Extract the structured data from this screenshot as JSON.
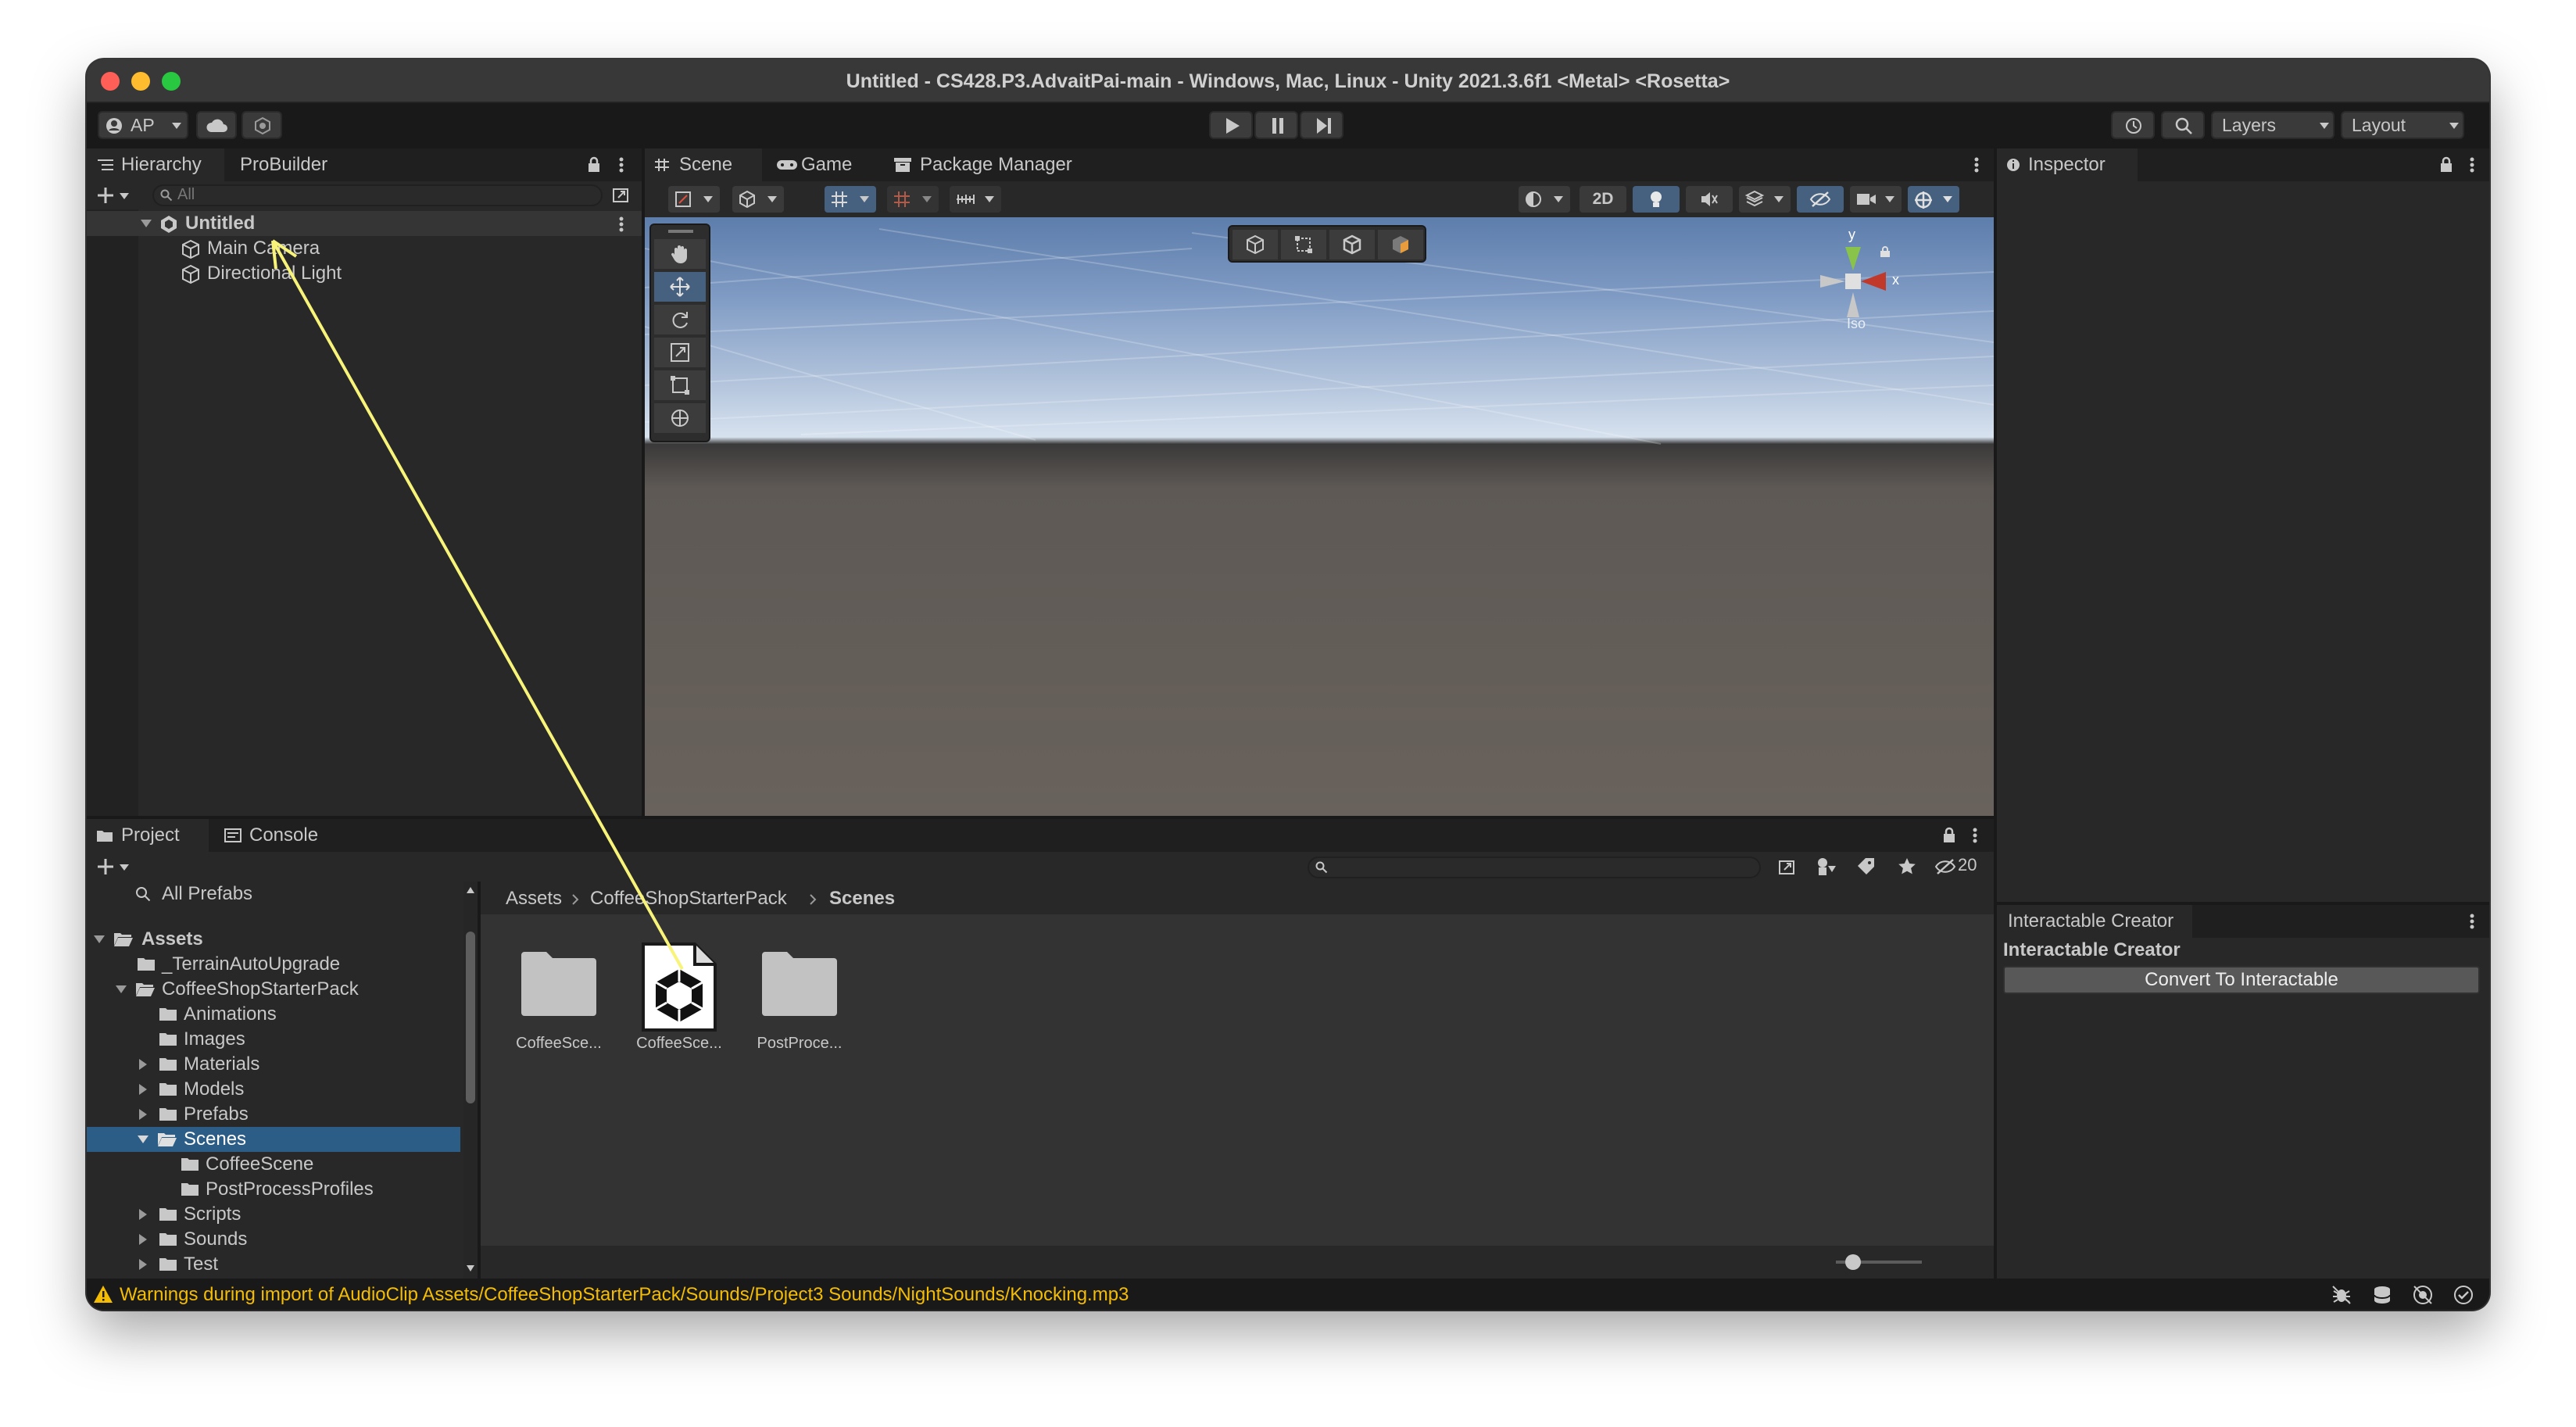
{
  "window": {
    "title": "Untitled - CS428.P3.AdvaitPai-main - Windows, Mac, Linux - Unity 2021.3.6f1 <Metal> <Rosetta>",
    "colors": {
      "close": "#ff5f57",
      "minimize": "#febc2e",
      "zoom": "#28c840",
      "accent": "#2c5d87",
      "warning": "#f4bc02",
      "annotation": "#f8f47a"
    }
  },
  "toolbar": {
    "account_label": "AP",
    "layers_label": "Layers",
    "layout_label": "Layout"
  },
  "hierarchy": {
    "tabs": [
      "Hierarchy",
      "ProBuilder"
    ],
    "search_placeholder": "All",
    "scene_name": "Untitled",
    "items": [
      "Main Camera",
      "Directional Light"
    ]
  },
  "scene_view": {
    "tabs": [
      "Scene",
      "Game",
      "Package Manager"
    ],
    "mode_2d": "2D",
    "gizmo": {
      "y": "y",
      "x": "x",
      "projection": "Iso"
    }
  },
  "inspector": {
    "tab": "Inspector",
    "component_tab": "Interactable Creator",
    "component_title": "Interactable Creator",
    "button_label": "Convert To Interactable"
  },
  "project": {
    "tabs": [
      "Project",
      "Console"
    ],
    "hidden_count": "20",
    "favorites": [
      "All Prefabs"
    ],
    "tree": {
      "root": "Assets",
      "items": [
        "_TerrainAutoUpgrade",
        "CoffeeShopStarterPack",
        "Animations",
        "Images",
        "Materials",
        "Models",
        "Prefabs",
        "Scenes",
        "CoffeeScene",
        "PostProcessProfiles",
        "Scripts",
        "Sounds",
        "Test"
      ],
      "selected": "Scenes"
    },
    "breadcrumb": [
      "Assets",
      "CoffeeShopStarterPack",
      "Scenes"
    ],
    "assets": [
      {
        "label": "CoffeeSce...",
        "icon": "folder-icon"
      },
      {
        "label": "CoffeeSce...",
        "icon": "unity-scene-icon"
      },
      {
        "label": "PostProce...",
        "icon": "folder-icon"
      }
    ]
  },
  "status_bar": {
    "message": "Warnings during import of AudioClip Assets/CoffeeShopStarterPack/Sounds/Project3 Sounds/NightSounds/Knocking.mp3"
  }
}
